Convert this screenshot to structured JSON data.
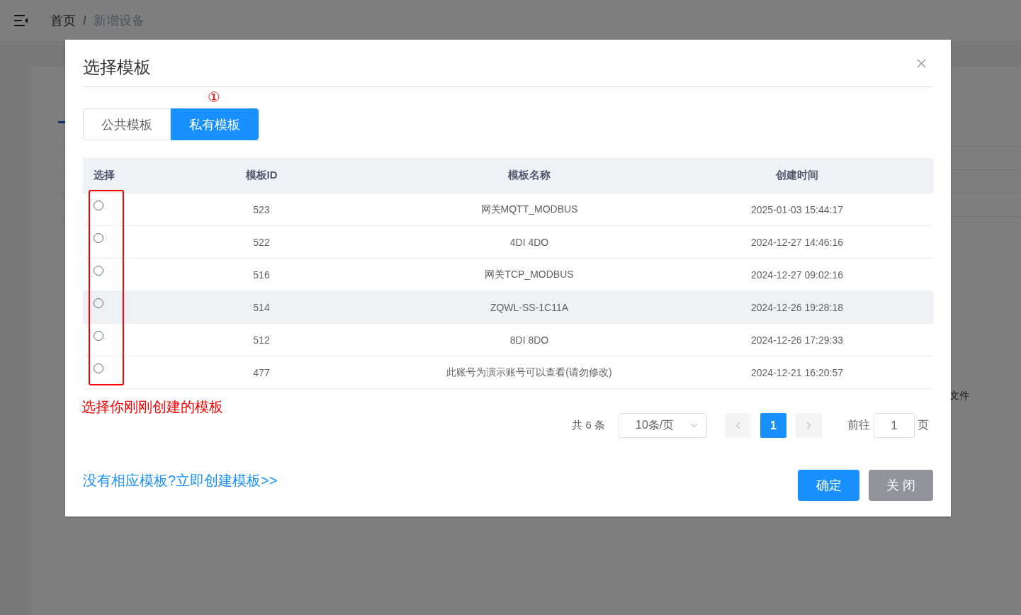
{
  "header": {
    "separator": "/",
    "breadcrumb": [
      {
        "label": "首页",
        "current": false
      },
      {
        "label": "新增设备",
        "current": true
      }
    ]
  },
  "background": {
    "side_text": "文件"
  },
  "dialog": {
    "title": "选择模板",
    "tabs": [
      {
        "label": "公共模板",
        "selected": false
      },
      {
        "label": "私有模板",
        "selected": true
      }
    ],
    "columns": [
      "选择",
      "模板ID",
      "模板名称",
      "创建时间"
    ],
    "rows": [
      {
        "selected": false,
        "highlighted": false,
        "id": "523",
        "name": "网关MQTT_MODBUS",
        "created": "2025-01-03 15:44:17"
      },
      {
        "selected": false,
        "highlighted": false,
        "id": "522",
        "name": "4DI 4DO",
        "created": "2024-12-27 14:46:16"
      },
      {
        "selected": false,
        "highlighted": false,
        "id": "516",
        "name": "网关TCP_MODBUS",
        "created": "2024-12-27 09:02:16"
      },
      {
        "selected": false,
        "highlighted": true,
        "id": "514",
        "name": "ZQWL-SS-1C11A",
        "created": "2024-12-26 19:28:18"
      },
      {
        "selected": false,
        "highlighted": false,
        "id": "512",
        "name": "8DI 8DO",
        "created": "2024-12-26 17:29:33"
      },
      {
        "selected": false,
        "highlighted": false,
        "id": "477",
        "name": "此账号为演示账号可以查看(请勿修改)",
        "created": "2024-12-21 16:20:57"
      }
    ],
    "pagination": {
      "total": "共 6 条",
      "page_size": "10条/页",
      "pages": [
        {
          "label": "1",
          "selected": true
        }
      ],
      "goto_label": "前往",
      "goto_value": "1",
      "goto_suffix": "页"
    },
    "create_link": "没有相应模板?立即创建模板>>",
    "buttons": [
      {
        "label": "确定",
        "kind": "primary"
      },
      {
        "label": "关 闭",
        "kind": "secondary"
      }
    ]
  },
  "annotations": {
    "step_marker": "①",
    "hint": "选择你刚刚创建的模板"
  }
}
